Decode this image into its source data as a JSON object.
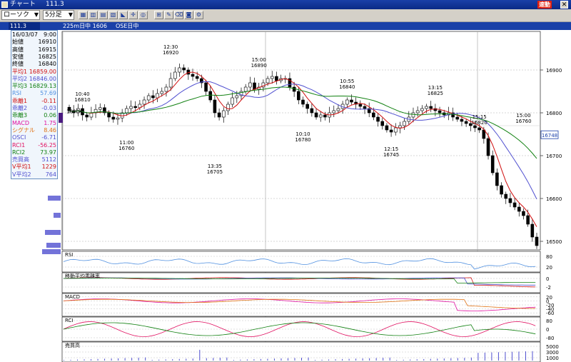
{
  "window": {
    "title": "チャート",
    "code": "111.3",
    "auto_badge": "速動",
    "close_glyph": "✕"
  },
  "toolbar": {
    "candle_select": "ローソク",
    "interval_select": "5分足",
    "tool_icons": [
      "grid-icon",
      "bar-chart-icon",
      "table-icon",
      "chart-icon",
      "line-chart-icon",
      "crosshair-icon",
      "zoom-icon",
      "ruler-icon",
      "pen-icon",
      "eraser-icon",
      "camera-icon",
      "settings-icon"
    ]
  },
  "infobar": {
    "code": "111.3",
    "text1": "225m日中 1606",
    "text2": "OSE日中"
  },
  "datapanel": {
    "rows": [
      {
        "k": "16/03/07",
        "v": "9:00",
        "color": "#000000"
      },
      {
        "k": "始値",
        "v": "16910",
        "color": "#000000"
      },
      {
        "k": "高値",
        "v": "16915",
        "color": "#000000"
      },
      {
        "k": "安値",
        "v": "16825",
        "color": "#000000"
      },
      {
        "k": "終値",
        "v": "16840",
        "color": "#000000"
      },
      {
        "k": "平均1",
        "v": "16859.00",
        "color": "#d01010"
      },
      {
        "k": "平均2",
        "v": "16846.00",
        "color": "#5050d0"
      },
      {
        "k": "平均3",
        "v": "16829.13",
        "color": "#108010"
      },
      {
        "k": "RSI",
        "v": "57.69",
        "color": "#5090e0"
      },
      {
        "k": "乖離1",
        "v": "-0.11",
        "color": "#d01010"
      },
      {
        "k": "乖離2",
        "v": "-0.03",
        "color": "#5050d0"
      },
      {
        "k": "乖離3",
        "v": "0.06",
        "color": "#108010"
      },
      {
        "k": "MACD",
        "v": "1.75",
        "color": "#e010a0"
      },
      {
        "k": "シグナル",
        "v": "8.46",
        "color": "#e07010"
      },
      {
        "k": "OSCI",
        "v": "-6.71",
        "color": "#5050d0"
      },
      {
        "k": "RCI1",
        "v": "-56.25",
        "color": "#e01060"
      },
      {
        "k": "RCI2",
        "v": "73.97",
        "color": "#108010"
      },
      {
        "k": "売買高",
        "v": "5112",
        "color": "#5050d0"
      },
      {
        "k": "V平均1",
        "v": "1229",
        "color": "#d01010"
      },
      {
        "k": "V平均2",
        "v": "764",
        "color": "#5050d0"
      }
    ]
  },
  "chart_data": [
    {
      "type": "candlestick",
      "price_axis_labels": [
        "16900",
        "16800",
        "16700",
        "16600",
        "16500"
      ],
      "ylim": [
        16480,
        16990
      ],
      "current_price_label": "16748",
      "open_label": "16804",
      "annotations": [
        {
          "time": "10:40",
          "price": "16810"
        },
        {
          "time": "11:00",
          "price": "16760"
        },
        {
          "time": "12:30",
          "price": "16920"
        },
        {
          "time": "13:35",
          "price": "16705"
        },
        {
          "time": "15:00",
          "price": "16890"
        },
        {
          "time": "10:10",
          "price": "16780"
        },
        {
          "time": "10:55",
          "price": "16840"
        },
        {
          "time": "12:15",
          "price": "16745"
        },
        {
          "time": "13:15",
          "price": "16825"
        },
        {
          "time": "15:15",
          "price": "16820"
        },
        {
          "time": "15:00",
          "price": "16760"
        }
      ],
      "closes": [
        16805,
        16800,
        16810,
        16795,
        16790,
        16800,
        16808,
        16812,
        16800,
        16790,
        16785,
        16788,
        16800,
        16810,
        16815,
        16812,
        16820,
        16830,
        16840,
        16835,
        16845,
        16850,
        16860,
        16880,
        16895,
        16905,
        16900,
        16890,
        16885,
        16880,
        16870,
        16850,
        16830,
        16800,
        16790,
        16805,
        16820,
        16835,
        16840,
        16850,
        16860,
        16870,
        16855,
        16860,
        16870,
        16880,
        16885,
        16875,
        16880,
        16880,
        16860,
        16850,
        16830,
        16820,
        16810,
        16800,
        16790,
        16795,
        16790,
        16800,
        16805,
        16810,
        16820,
        16830,
        16825,
        16820,
        16815,
        16810,
        16800,
        16790,
        16780,
        16770,
        16760,
        16755,
        16765,
        16770,
        16780,
        16790,
        16800,
        16805,
        16810,
        16815,
        16810,
        16805,
        16800,
        16795,
        16800,
        16790,
        16785,
        16780,
        16775,
        16770,
        16765,
        16760,
        16740,
        16700,
        16660,
        16630,
        16610,
        16600,
        16590,
        16580,
        16570,
        16560,
        16540,
        16510,
        16490
      ],
      "ma1_color": "#d01010",
      "ma2_color": "#5050d0",
      "ma3_color": "#108010"
    },
    {
      "type": "line",
      "name": "RSI",
      "y_labels": [
        "80",
        "20"
      ],
      "ylim": [
        0,
        100
      ]
    },
    {
      "type": "line",
      "name": "移動平均乖離率",
      "y_labels": [
        "0",
        "-2"
      ],
      "ylim": [
        -3,
        1
      ]
    },
    {
      "type": "line",
      "name": "MACD",
      "y_labels": [
        "20",
        "0",
        "-20",
        "-40",
        "-60"
      ],
      "ylim": [
        -70,
        30
      ]
    },
    {
      "type": "line",
      "name": "RCI",
      "y_labels": [
        "80",
        "0",
        "-80"
      ],
      "ylim": [
        -100,
        100
      ]
    },
    {
      "type": "bar",
      "name": "売買高",
      "y_labels": [
        "5000",
        "3000",
        "1000"
      ],
      "ylim": [
        0,
        6000
      ]
    }
  ]
}
